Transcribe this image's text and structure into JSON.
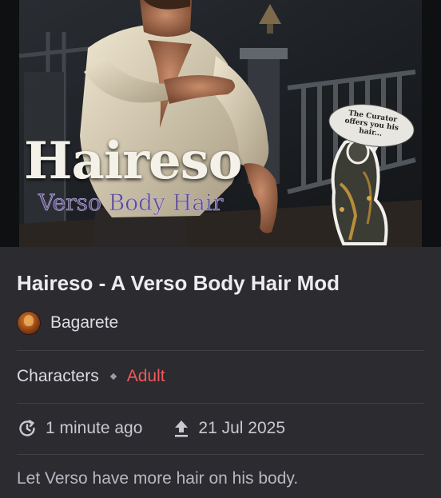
{
  "hero": {
    "title": "Haireso",
    "subtitle": "Verso Body Hair",
    "speech_bubble": "The Curator offers you his hair..."
  },
  "mod": {
    "title": "Haireso - A Verso Body Hair Mod",
    "author": "Bagarete",
    "category": "Characters",
    "rating_tag": "Adult",
    "updated": "1 minute ago",
    "uploaded": "21 Jul 2025",
    "description": "Let Verso have more hair on his body."
  },
  "icons": {
    "updated": "clock-refresh-icon",
    "uploaded": "upload-arrow-icon",
    "separator": "diamond-separator-icon"
  },
  "colors": {
    "card_bg": "#2b2b30",
    "text_primary": "#ecebf0",
    "text_secondary": "#c9c8d0",
    "adult_tag": "#ef5a5a",
    "divider": "#404047"
  }
}
